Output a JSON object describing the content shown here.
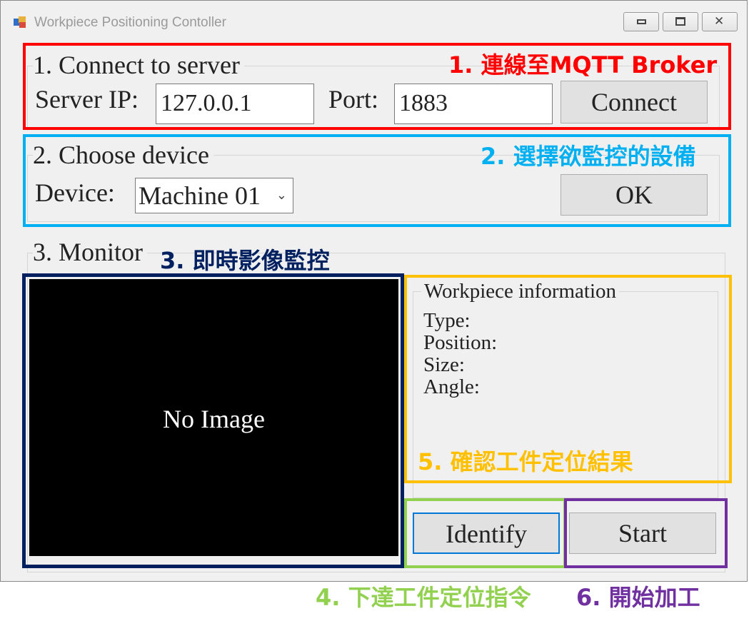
{
  "window": {
    "title": "Workpiece Positioning Contoller"
  },
  "server": {
    "group_label": "1. Connect to server",
    "ip_label": "Server IP:",
    "ip_value": "127.0.0.1",
    "port_label": "Port:",
    "port_value": "1883",
    "connect_label": "Connect"
  },
  "device": {
    "group_label": "2. Choose device",
    "device_label": "Device:",
    "selected": "Machine 01",
    "ok_label": "OK"
  },
  "monitor": {
    "group_label": "3. Monitor",
    "image_placeholder": "No Image",
    "info_group_label": "Workpiece information",
    "info_fields": [
      "Type:",
      "Position:",
      "Size:",
      "Angle:"
    ],
    "identify_label": "Identify",
    "start_label": "Start"
  },
  "annotations": {
    "a1": "1. 連線至MQTT Broker",
    "a2": "2. 選擇欲監控的設備",
    "a3": "3. 即時影像監控",
    "a4": "4. 下達工件定位指令",
    "a5": "5. 確認工件定位結果",
    "a6": "6. 開始加工"
  },
  "colors": {
    "red": "#ff0000",
    "cyan": "#00b0f0",
    "navy": "#002060",
    "yellow": "#ffc000",
    "green": "#92d050",
    "purple": "#7030a0"
  }
}
